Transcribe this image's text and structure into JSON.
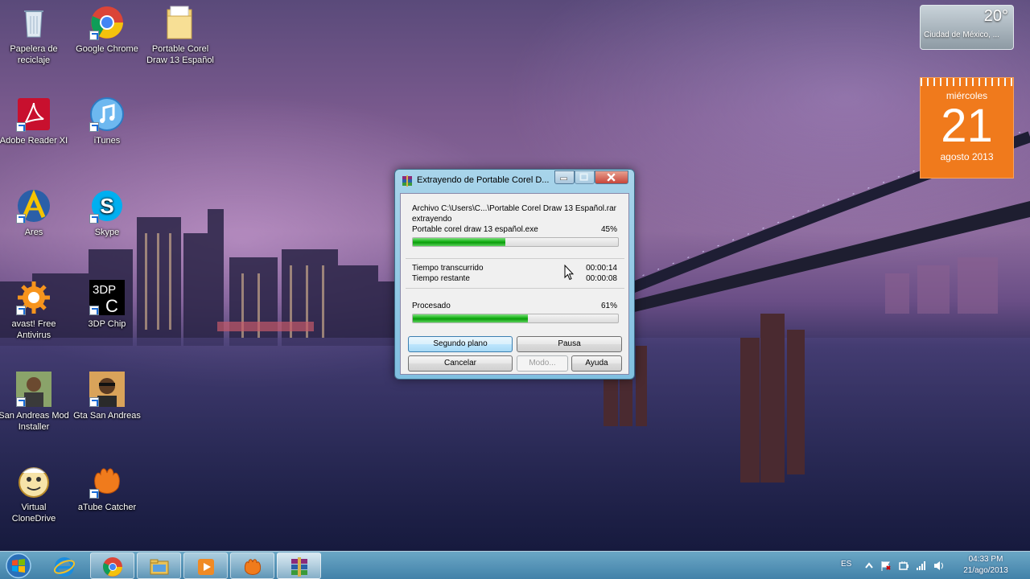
{
  "desktop": {
    "icons": [
      {
        "label": "Papelera de\nreciclaje",
        "icon": "recycle-bin-icon"
      },
      {
        "label": "Google Chrome",
        "icon": "chrome-icon"
      },
      {
        "label": "Portable Corel\nDraw 13 Español",
        "icon": "folder-icon"
      },
      {
        "label": "Adobe Reader XI",
        "icon": "adobe-reader-icon"
      },
      {
        "label": "iTunes",
        "icon": "itunes-icon"
      },
      {
        "label": "Ares",
        "icon": "ares-icon"
      },
      {
        "label": "Skype",
        "icon": "skype-icon"
      },
      {
        "label": "avast! Free\nAntivirus",
        "icon": "avast-icon"
      },
      {
        "label": "3DP Chip",
        "icon": "3dp-chip-icon"
      },
      {
        "label": "San Andreas Mod\nInstaller",
        "icon": "san-andreas-icon"
      },
      {
        "label": "Gta San Andreas",
        "icon": "gta-icon"
      },
      {
        "label": "Virtual\nCloneDrive",
        "icon": "clonedrive-icon"
      },
      {
        "label": "aTube Catcher",
        "icon": "atube-catcher-icon"
      }
    ]
  },
  "gadgets": {
    "weather": {
      "temp": "20°",
      "city": "Ciudad de México, ..."
    },
    "calendar": {
      "weekday": "miércoles",
      "day": "21",
      "month_year": "agosto 2013",
      "color": "#f07a1c"
    }
  },
  "dialog": {
    "title": "Extrayendo de Portable Corel D...",
    "archive_line": "Archivo C:\\Users\\C...\\Portable Corel Draw 13 Español.rar",
    "status": "extrayendo",
    "current_file": "Portable corel draw 13 español.exe",
    "file_percent": "45%",
    "file_progress": 0.45,
    "elapsed_label": "Tiempo transcurrido",
    "elapsed_value": "00:00:14",
    "remaining_label": "Tiempo restante",
    "remaining_value": "00:00:08",
    "processed_label": "Procesado",
    "processed_percent": "61%",
    "processed_progress": 0.56,
    "buttons": {
      "background": "Segundo plano",
      "pause": "Pausa",
      "cancel": "Cancelar",
      "mode": "Modo...",
      "help": "Ayuda"
    }
  },
  "taskbar": {
    "apps": [
      "internet-explorer-icon",
      "chrome-icon",
      "file-explorer-icon",
      "media-player-icon",
      "atube-catcher-icon",
      "winrar-icon"
    ],
    "language": "ES",
    "time": "04:33 PM",
    "date": "21/ago/2013"
  }
}
